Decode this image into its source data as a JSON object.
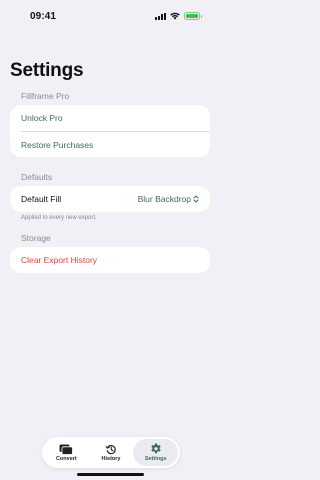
{
  "status": {
    "time": "09:41",
    "battery_level": 1.0
  },
  "page_title": "Settings",
  "pro_section": {
    "header": "Fillframe Pro",
    "items": [
      "Unlock Pro",
      "Restore Purchases"
    ]
  },
  "defaults_section": {
    "header": "Defaults",
    "label": "Default Fill",
    "value": "Blur Backdrop",
    "footnote": "Applied to every new export."
  },
  "storage_section": {
    "header": "Storage",
    "action": "Clear Export History"
  },
  "tabs": [
    {
      "label": "Convert",
      "icon": "convert-icon"
    },
    {
      "label": "History",
      "icon": "history-icon"
    },
    {
      "label": "Settings",
      "icon": "gear-icon",
      "selected": true
    }
  ],
  "colors": {
    "accent": "#3c6b5d",
    "destructive": "#e0443d",
    "background": "#f1f0f6"
  }
}
